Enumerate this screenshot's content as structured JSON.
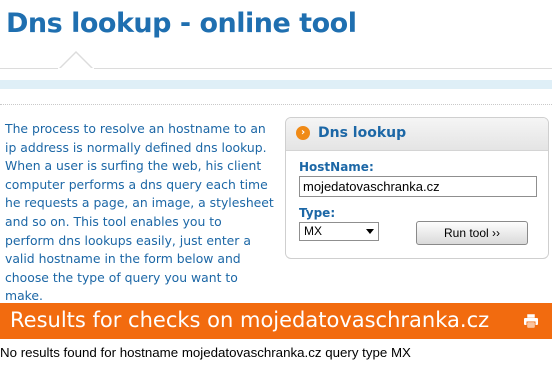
{
  "page": {
    "title": "Dns lookup - online tool",
    "intro": "The process to resolve an hostname to an ip address is normally defined dns lookup. When a user is surfing the web, his client computer performs a dns query each time he requests a page, an image, a stylesheet and so on. This tool enables you to perform dns lookups easily, just enter a valid hostname in the form below and choose the type of query you want to make."
  },
  "tool": {
    "title": "Dns lookup",
    "icon": "arrow-right-icon",
    "hostname_label": "HostName:",
    "hostname_value": "mojedatovaschranka.cz",
    "type_label": "Type:",
    "type_value": "MX",
    "run_button": "Run tool ››"
  },
  "results": {
    "title": "Results for checks on mojedatovaschranka.cz",
    "message": "No results found for hostname mojedatovaschranka.cz query type MX",
    "print_icon": "printer-icon"
  },
  "colors": {
    "accent_blue": "#1f6fb0",
    "results_orange": "#f26b0f",
    "strip_blue": "#dfeff7"
  }
}
